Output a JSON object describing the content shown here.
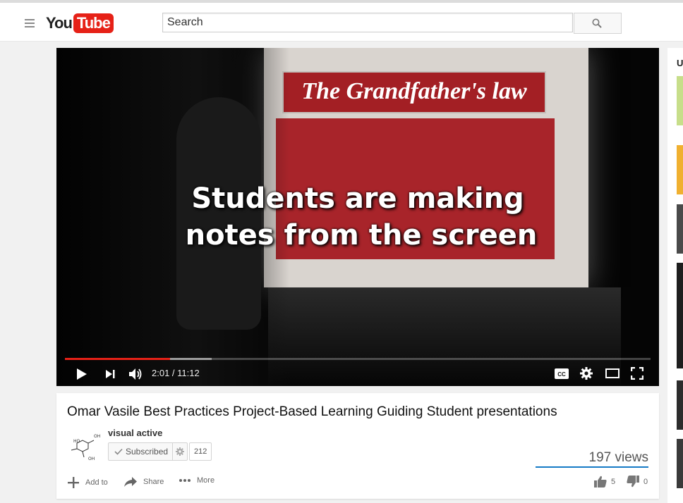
{
  "masthead": {
    "logo_you": "You",
    "logo_tube": "Tube",
    "search_placeholder": "Search"
  },
  "video": {
    "slide_heading": "The Grandfather's law",
    "caption_line1": "Students are making",
    "caption_line2": "notes from the screen",
    "time": "2:01 / 11:12",
    "progress_fraction": 0.18,
    "loaded_fraction": 0.25
  },
  "info": {
    "title": "Omar Vasile Best Practices Project-Based Learning Guiding Student presentations",
    "channel_name": "visual active",
    "subscribe_label": "Subscribed",
    "subscriber_count": "212",
    "views": "197 views",
    "actions": {
      "add_to": "Add to",
      "share": "Share",
      "more": "More"
    },
    "likes": "5",
    "dislikes": "0"
  },
  "sidebar": {
    "heading": "U"
  },
  "colors": {
    "brand_red": "#e62117",
    "like_bar": "#167ac6"
  }
}
